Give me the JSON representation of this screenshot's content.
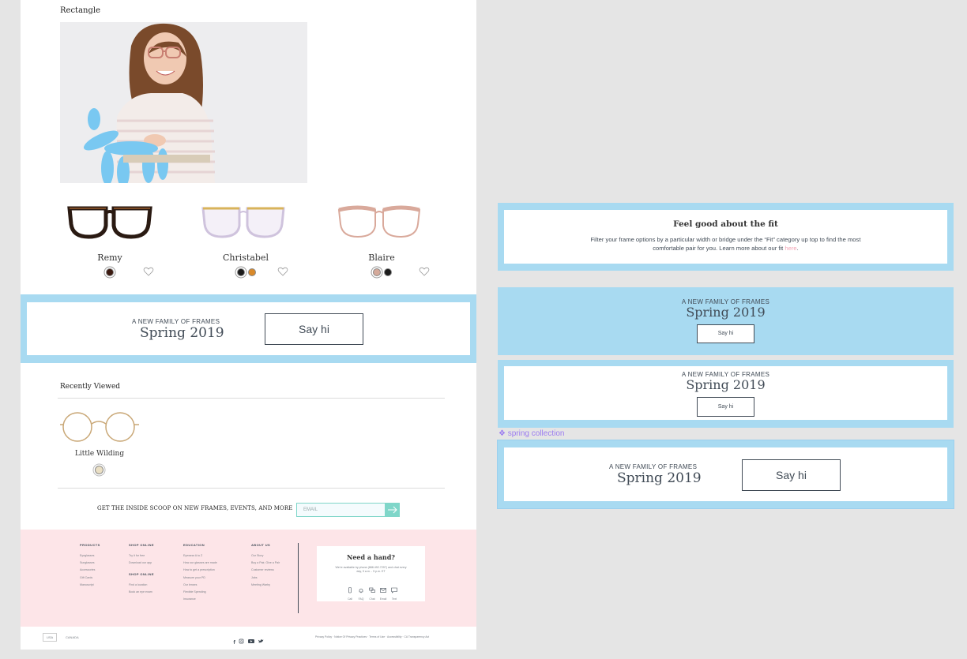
{
  "section_label": "Rectangle",
  "frames": [
    {
      "name": "Remy",
      "swatches": [
        "#3b1a10"
      ]
    },
    {
      "name": "Christabel",
      "swatches": [
        "#1b1b1b",
        "#d9892a"
      ]
    },
    {
      "name": "Blaire",
      "swatches": [
        "#d4a99a",
        "#1b1b1b"
      ]
    }
  ],
  "promo": {
    "kicker": "A NEW FAMILY OF FRAMES",
    "title": "Spring 2019",
    "button": "Say hi"
  },
  "recently_viewed": {
    "heading": "Recently Viewed",
    "item_name": "Little Wilding",
    "swatch": "#eadfc4"
  },
  "newsletter": {
    "text": "GET THE INSIDE SCOOP ON NEW FRAMES, EVENTS, AND MORE",
    "placeholder": "EMAIL"
  },
  "footer": {
    "products_h": "PRODUCTS",
    "products": [
      "Eyeglasses",
      "Sunglasses",
      "Accessories",
      "Gift Cards",
      "Manuscript"
    ],
    "shop_h": "SHOP ONLINE",
    "shop": [
      "Try it for free",
      "Download our app"
    ],
    "shop2_h": "SHOP ONLINE",
    "shop2": [
      "Find a location",
      "Book an eye exam"
    ],
    "edu_h": "EDUCATION",
    "edu": [
      "Eyewear A to Z",
      "How our glasses are made",
      "How to get a prescription",
      "Measure your PD",
      "Our lenses",
      "Flexible Spending",
      "Insurance"
    ],
    "about_h": "ABOUT US",
    "about": [
      "Our Story",
      "Buy a Pair, Give a Pair",
      "Customer reviews",
      "Jobs",
      "Meeting Warby"
    ],
    "help_title": "Need a hand?",
    "help_text_1": "We're available by phone (888.492.7297) and chat every",
    "help_text_2": "day, 9 a.m. - 9 p.m. ET",
    "contacts": [
      "Call",
      "FAQ",
      "Chat",
      "Email",
      "Text"
    ]
  },
  "bottom": {
    "country_usa": "USA",
    "country_canada": "CANADA",
    "legal": [
      "Privacy Policy",
      "Notice Of Privacy Practices",
      "Terms of Use",
      "Accessibility",
      "CA Transparency Act"
    ]
  },
  "fit_panel": {
    "title": "Feel good about the fit",
    "body_1": "Filter your frame options by a particular width or bridge under the “Fit” category up top to find the most",
    "body_2": "comfortable pair for you. Learn more about our fit",
    "link": "here",
    "period": "."
  },
  "component_label": "spring collection",
  "colors": {
    "accent_blue": "#a8daf1",
    "footer_pink": "#fde5e8",
    "ink": "#414b56",
    "component_purple": "#9b7cf0",
    "newsletter_teal": "#7fd6c9"
  }
}
